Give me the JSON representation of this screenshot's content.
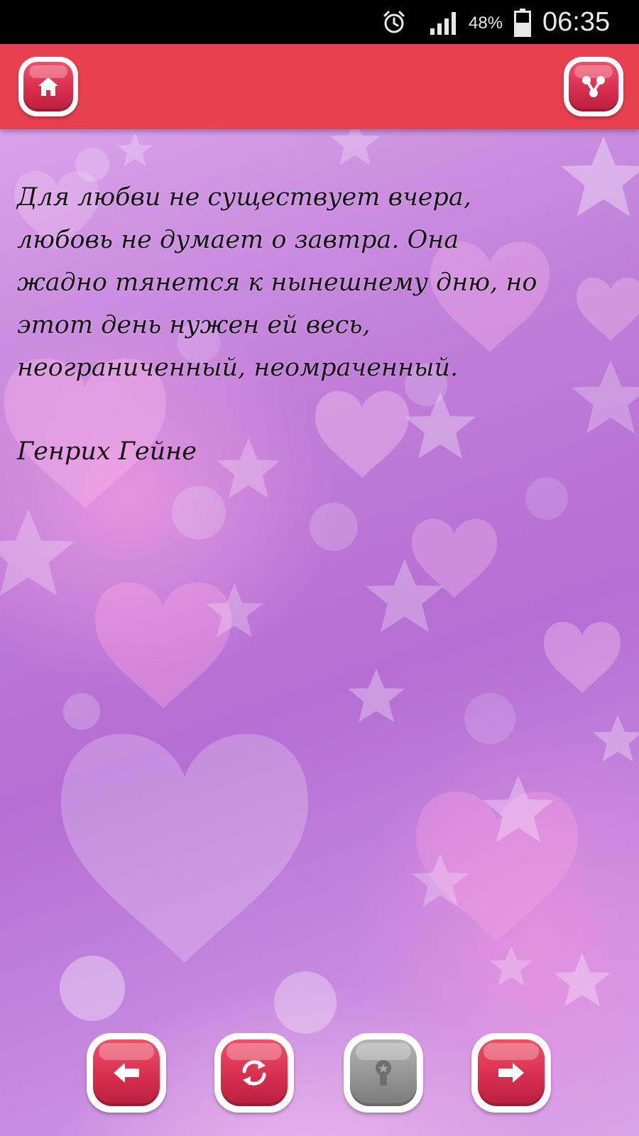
{
  "status_bar": {
    "battery_percent": "48%",
    "time": "06:35"
  },
  "icons": {
    "status": [
      "alarm-icon",
      "signal-icon",
      "battery-icon"
    ],
    "toolbar": [
      "home-icon",
      "share-icon"
    ],
    "bottom": [
      "arrow-left-icon",
      "shuffle-icon",
      "favorite-icon",
      "arrow-right-icon"
    ]
  },
  "colors": {
    "top_bar": "#e94050",
    "button_red": "#d92e4e",
    "button_disabled": "#949494",
    "background": "#c07ed8"
  },
  "quote": {
    "lines": [
      "Для любви не существует вчера,",
      "любовь не думает о завтра. Она",
      "жадно тянется к нынешнему дню, но",
      "этот день нужен ей весь,",
      "неограниченный, неомраченный."
    ],
    "author": "Генрих Гейне"
  }
}
